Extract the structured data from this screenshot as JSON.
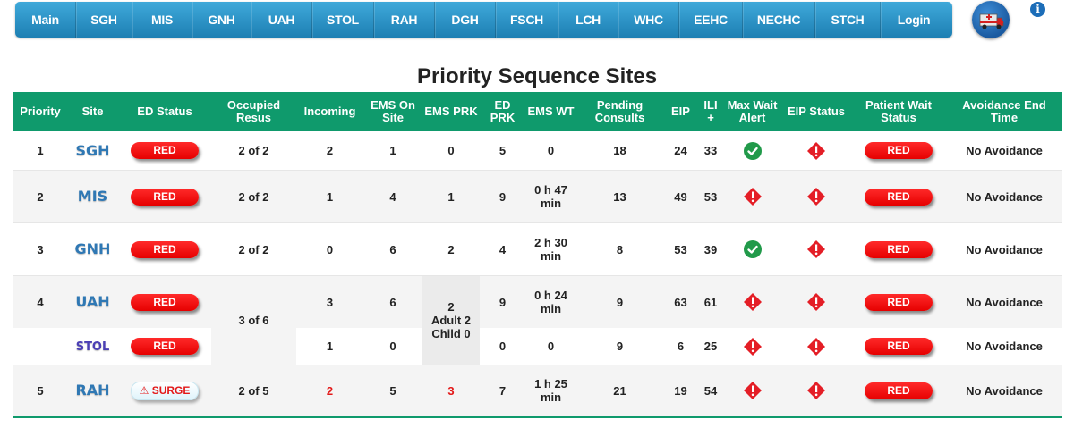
{
  "nav": [
    "Main",
    "SGH",
    "MIS",
    "GNH",
    "UAH",
    "STOL",
    "RAH",
    "DGH",
    "FSCH",
    "LCH",
    "WHC",
    "EEHC",
    "NECHC",
    "STCH",
    "Login"
  ],
  "info_glyph": "i",
  "title": "Priority Sequence Sites",
  "headers": {
    "priority": "Priority",
    "site": "Site",
    "ed_status": "ED Status",
    "occupied_resus": "Occupied Resus",
    "incoming": "Incoming",
    "ems_on_site": "EMS On Site",
    "ems_prk": "EMS PRK",
    "ed_prk": "ED PRK",
    "ems_wt": "EMS WT",
    "pending_consults": "Pending Consults",
    "eip": "EIP",
    "ili": "ILI +",
    "max_wait_alert": "Max Wait Alert",
    "eip_status": "EIP Status",
    "patient_wait_status": "Patient Wait Status",
    "avoidance_end_time": "Avoidance End Time"
  },
  "rows": [
    {
      "priority": "1",
      "site": "SGH",
      "ed_status": "RED",
      "occupied_resus": "2 of 2",
      "incoming": "2",
      "ems_on_site": "1",
      "ems_prk": "0",
      "ed_prk": "5",
      "ems_wt": "0",
      "pending_consults": "18",
      "eip": "24",
      "ili": "33",
      "max_wait_alert": "ok-icon",
      "eip_status": "alert-icon",
      "patient_wait_status": "RED",
      "avoidance": "No Avoidance"
    },
    {
      "priority": "2",
      "site": "MIS",
      "ed_status": "RED",
      "occupied_resus": "2 of 2",
      "incoming": "1",
      "ems_on_site": "4",
      "ems_prk": "1",
      "ed_prk": "9",
      "ems_wt": "0 h 47 min",
      "pending_consults": "13",
      "eip": "49",
      "ili": "53",
      "max_wait_alert": "alert-icon",
      "eip_status": "alert-icon",
      "patient_wait_status": "RED",
      "avoidance": "No Avoidance"
    },
    {
      "priority": "3",
      "site": "GNH",
      "ed_status": "RED",
      "occupied_resus": "2 of 2",
      "incoming": "0",
      "ems_on_site": "6",
      "ems_prk": "2",
      "ed_prk": "4",
      "ems_wt": "2 h 30 min",
      "pending_consults": "8",
      "eip": "53",
      "ili": "39",
      "max_wait_alert": "ok-icon",
      "eip_status": "alert-icon",
      "patient_wait_status": "RED",
      "avoidance": "No Avoidance"
    },
    {
      "priority": "4",
      "site": "UAH",
      "ed_status": "RED",
      "occupied_resus": "3 of 6",
      "incoming": "3",
      "ems_on_site": "6",
      "ems_prk": "2",
      "ems_prk_adult": "Adult 2",
      "ems_prk_child": "Child 0",
      "ed_prk": "9",
      "ems_wt": "0 h 24 min",
      "pending_consults": "9",
      "eip": "63",
      "ili": "61",
      "max_wait_alert": "alert-icon",
      "eip_status": "alert-icon",
      "patient_wait_status": "RED",
      "avoidance": "No Avoidance"
    },
    {
      "priority": "",
      "site": "STOL",
      "ed_status": "RED",
      "incoming": "1",
      "ems_on_site": "0",
      "ed_prk": "0",
      "ems_wt": "0",
      "pending_consults": "9",
      "eip": "6",
      "ili": "25",
      "max_wait_alert": "alert-icon",
      "eip_status": "alert-icon",
      "patient_wait_status": "RED",
      "avoidance": "No Avoidance"
    },
    {
      "priority": "5",
      "site": "RAH",
      "ed_status": "⚠ SURGE",
      "occupied_resus": "2 of 5",
      "incoming": "2",
      "ems_on_site": "5",
      "ems_prk": "3",
      "ed_prk": "7",
      "ems_wt": "1 h 25 min",
      "pending_consults": "21",
      "eip": "19",
      "ili": "54",
      "max_wait_alert": "alert-icon",
      "eip_status": "alert-icon",
      "patient_wait_status": "RED",
      "avoidance": "No Avoidance"
    }
  ],
  "colors": {
    "header_bg": "#0f9a6c",
    "nav_bg": "#2b94c9",
    "red_pill": "#ff1a1a",
    "ok_green": "#219a4a",
    "alert_red": "#e41e26"
  }
}
